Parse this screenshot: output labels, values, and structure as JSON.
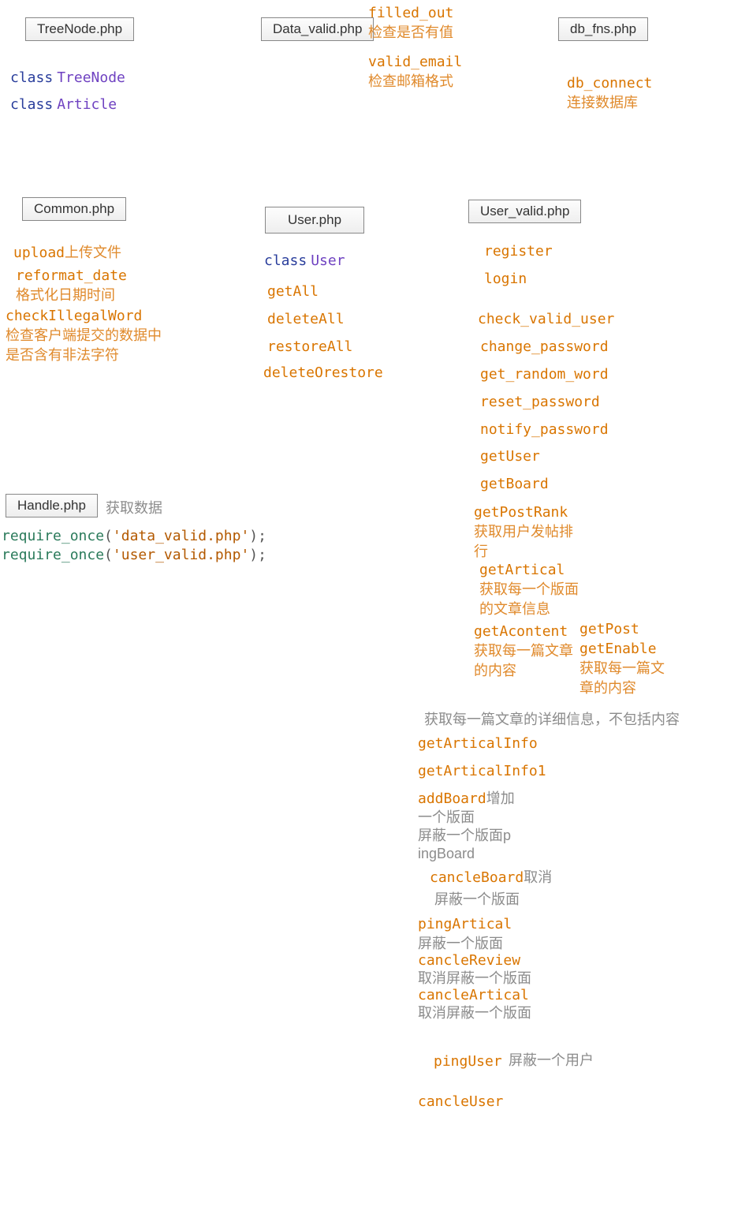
{
  "files": {
    "treenode": {
      "title": "TreeNode.php"
    },
    "data_valid": {
      "title": "Data_valid.php"
    },
    "db_fns": {
      "title": "db_fns.php"
    },
    "common": {
      "title": "Common.php"
    },
    "user": {
      "title": "User.php"
    },
    "user_valid": {
      "title": "User_valid.php"
    },
    "handle": {
      "title": "Handle.php"
    }
  },
  "kw": {
    "class": "class",
    "require_once": "require_once"
  },
  "classes": {
    "TreeNode": "TreeNode",
    "Article": "Article",
    "User": "User"
  },
  "data_valid": {
    "filled_out": "filled_out",
    "filled_out_desc": "检查是否有值",
    "valid_email": "valid_email",
    "valid_email_desc": "检查邮箱格式"
  },
  "db_fns": {
    "db_connect": "db_connect",
    "db_connect_desc": "连接数据库"
  },
  "common": {
    "upload": "upload",
    "upload_desc": "上传文件",
    "reformat_date": "reformat_date",
    "reformat_date_desc": "格式化日期时间",
    "checkIllegalWord": "checkIllegalWord",
    "checkIllegalWord_desc": "检查客户端提交的数据中是否含有非法字符"
  },
  "user": {
    "getAll": "getAll",
    "deleteAll": "deleteAll",
    "restoreAll": "restoreAll",
    "deleteOrestore": "deleteOrestore"
  },
  "uv": {
    "register": "register",
    "login": "login",
    "check_valid_user": "check_valid_user",
    "change_password": "change_password",
    "get_random_word": "get_random_word",
    "reset_password": "reset_password",
    "notify_password": "notify_password",
    "getUser": "getUser",
    "getBoard": "getBoard",
    "getPostRank": "getPostRank",
    "getPostRank_desc": "获取用户发帖排行",
    "getArtical": "getArtical",
    "getArtical_desc": "获取每一个版面的文章信息",
    "getAcontent": "getAcontent",
    "getAcontent_desc": "获取每一篇文章的内容",
    "getPost": "getPost",
    "getEnable": "getEnable",
    "getEnable_desc": "获取每一篇文章的内容",
    "getArticalInfo_note": "获取每一篇文章的详细信息，不包括内容",
    "getArticalInfo": "getArticalInfo",
    "getArticalInfo1": "getArticalInfo1",
    "addBoard": "addBoard",
    "addBoard_inline": "增加",
    "addBoard_desc2": "一个版面",
    "pingBoard_line": "屏蔽一个版面pingBoard",
    "pingBoard_pre": "屏蔽一个版面p",
    "pingBoard_suf": "ingBoard",
    "cancleBoard": "cancleBoard",
    "cancleBoard_inline": "取消",
    "cancleBoard_desc": "屏蔽一个版面",
    "pingArtical": "pingArtical",
    "pingArtical_desc": "屏蔽一个版面",
    "cancleReview": "cancleReview",
    "cancleReview_desc": "取消屏蔽一个版面",
    "cancleArtical": "cancleArtical",
    "cancleArtical_desc": "取消屏蔽一个版面",
    "pingUser": "pingUser",
    "pingUser_desc": "屏蔽一个用户",
    "cancleUser": "cancleUser"
  },
  "handle": {
    "side_note": "获取数据",
    "line1_str": "'data_valid.php'",
    "line2_str": "'user_valid.php'",
    "paren_open": "(",
    "paren_close": ");"
  }
}
